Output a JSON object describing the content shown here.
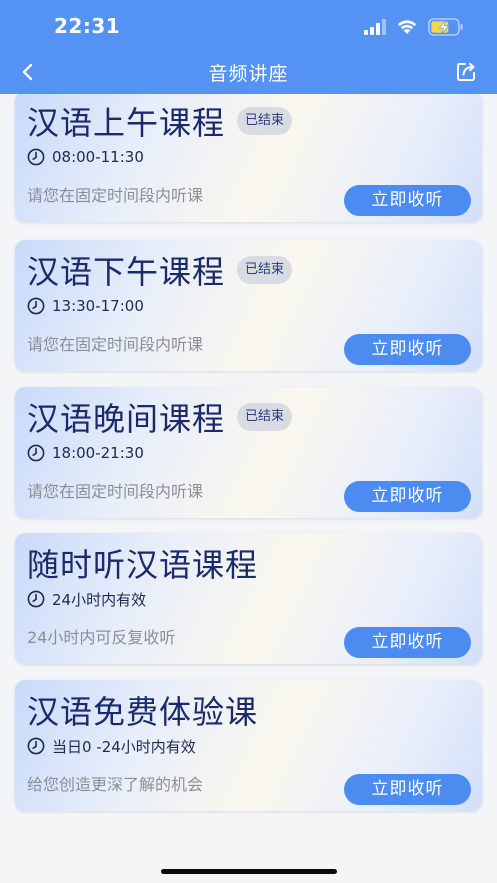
{
  "status_bar": {
    "time": "22:31"
  },
  "nav": {
    "title": "音频讲座",
    "back_icon": "chevron-left-icon",
    "share_icon": "share-icon"
  },
  "colors": {
    "brand_blue": "#5492f4",
    "button_blue": "#4c8cf0",
    "title_navy": "#1b2a6b",
    "badge_gray": "#d9dbe3",
    "desc_gray": "#8b8e96",
    "page_bg": "#f4f5f7"
  },
  "courses": [
    {
      "title": "汉语上午课程",
      "badge": "已结束",
      "time": "08:00-11:30",
      "description": "请您在固定时间段内听课",
      "button_label": "立即收听"
    },
    {
      "title": "汉语下午课程",
      "badge": "已结束",
      "time": "13:30-17:00",
      "description": "请您在固定时间段内听课",
      "button_label": "立即收听"
    },
    {
      "title": "汉语晚间课程",
      "badge": "已结束",
      "time": "18:00-21:30",
      "description": "请您在固定时间段内听课",
      "button_label": "立即收听"
    },
    {
      "title": "随时听汉语课程",
      "badge": "",
      "time": "24小时内有效",
      "description": "24小时内可反复收听",
      "button_label": "立即收听"
    },
    {
      "title": "汉语免费体验课",
      "badge": "",
      "time": "当日0 -24小时内有效",
      "description": "给您创造更深了解的机会",
      "button_label": "立即收听"
    }
  ]
}
